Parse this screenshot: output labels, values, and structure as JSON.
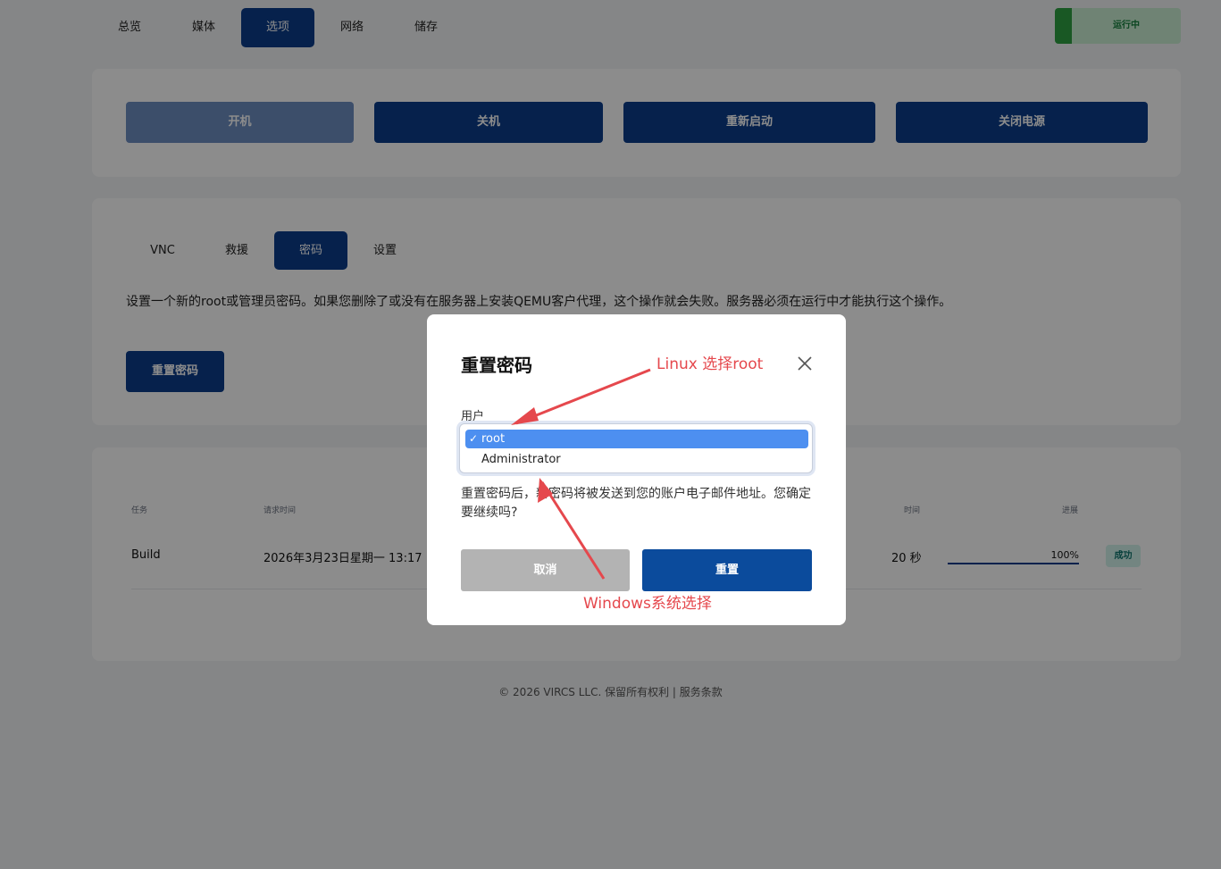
{
  "nav": {
    "tabs": [
      {
        "label": "总览"
      },
      {
        "label": "媒体"
      },
      {
        "label": "选项"
      },
      {
        "label": "网络"
      },
      {
        "label": "储存"
      }
    ],
    "status": "运行中",
    "status_color": "#2ea043"
  },
  "power": {
    "start": "开机",
    "shutdown": "关机",
    "reboot": "重新启动",
    "poweroff": "关闭电源"
  },
  "options": {
    "tabs": [
      {
        "label": "VNC"
      },
      {
        "label": "救援"
      },
      {
        "label": "密码"
      },
      {
        "label": "设置"
      }
    ],
    "description": "设置一个新的root或管理员密码。如果您删除了或没有在服务器上安装QEMU客户代理，这个操作就会失败。服务器必须在运行中才能执行这个操作。",
    "reset_button": "重置密码"
  },
  "tasks": {
    "headers": {
      "task": "任务",
      "request_time": "请求时间",
      "time": "时间",
      "progress": "进展"
    },
    "rows": [
      {
        "task": "Build",
        "request_time": "2026年3月23日星期一 13:17",
        "time": "20 秒",
        "progress": "100%",
        "progress_value": 1.0,
        "status": "成功"
      }
    ]
  },
  "footer": "© 2026 VIRCS LLC. 保留所有权利 | 服务条款",
  "modal": {
    "title": "重置密码",
    "user_label": "用户",
    "options": [
      {
        "label": "root",
        "selected": true
      },
      {
        "label": "Administrator",
        "selected": false
      }
    ],
    "message": "重置密码后，新密码将被发送到您的账户电子邮件地址。您确定要继续吗?",
    "cancel": "取消",
    "confirm": "重置"
  },
  "annotations": {
    "linux": "Linux 选择root",
    "windows": "Windows系统选择",
    "color": "#e5484d"
  },
  "colors": {
    "primary": "#0b3d8a",
    "disabled": "#6e8fc2",
    "success_bg": "#d1f2ec"
  }
}
